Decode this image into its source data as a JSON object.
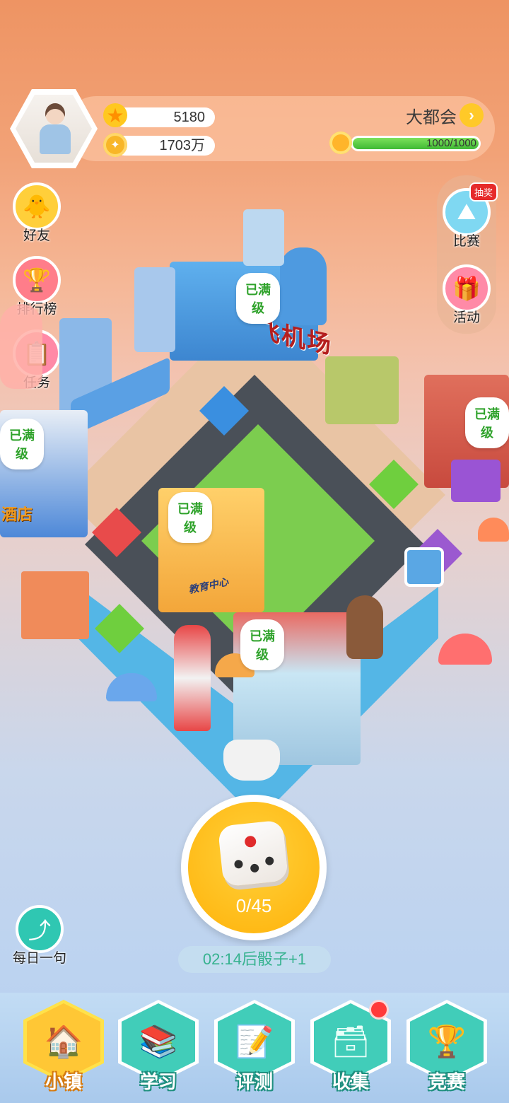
{
  "header": {
    "stars": "5180",
    "coins": "1703万",
    "city_name": "大都会",
    "level_progress_text": "1000/1000",
    "level_progress_fraction": 1.0
  },
  "left_menu": {
    "friends": "好友",
    "ranking": "排行榜",
    "tasks": "任务"
  },
  "right_menu": {
    "lottery_badge": "抽奖",
    "contest": "比赛",
    "events": "活动"
  },
  "board": {
    "airport_sign": "飞机场",
    "hotel_sign": "酒店",
    "office_sign": "教育中心",
    "maxed_label": "已满级"
  },
  "dice": {
    "count": "0/45",
    "timer_text": "02:14后骰子+1"
  },
  "daily_sentence": "每日一句",
  "bottom_nav": {
    "town": "小镇",
    "study": "学习",
    "test": "评测",
    "collect": "收集",
    "compete": "竞赛"
  },
  "colors": {
    "accent_teal": "#41cdb9",
    "active_yellow": "#ffc735",
    "maxed_green": "#2ea22a"
  }
}
